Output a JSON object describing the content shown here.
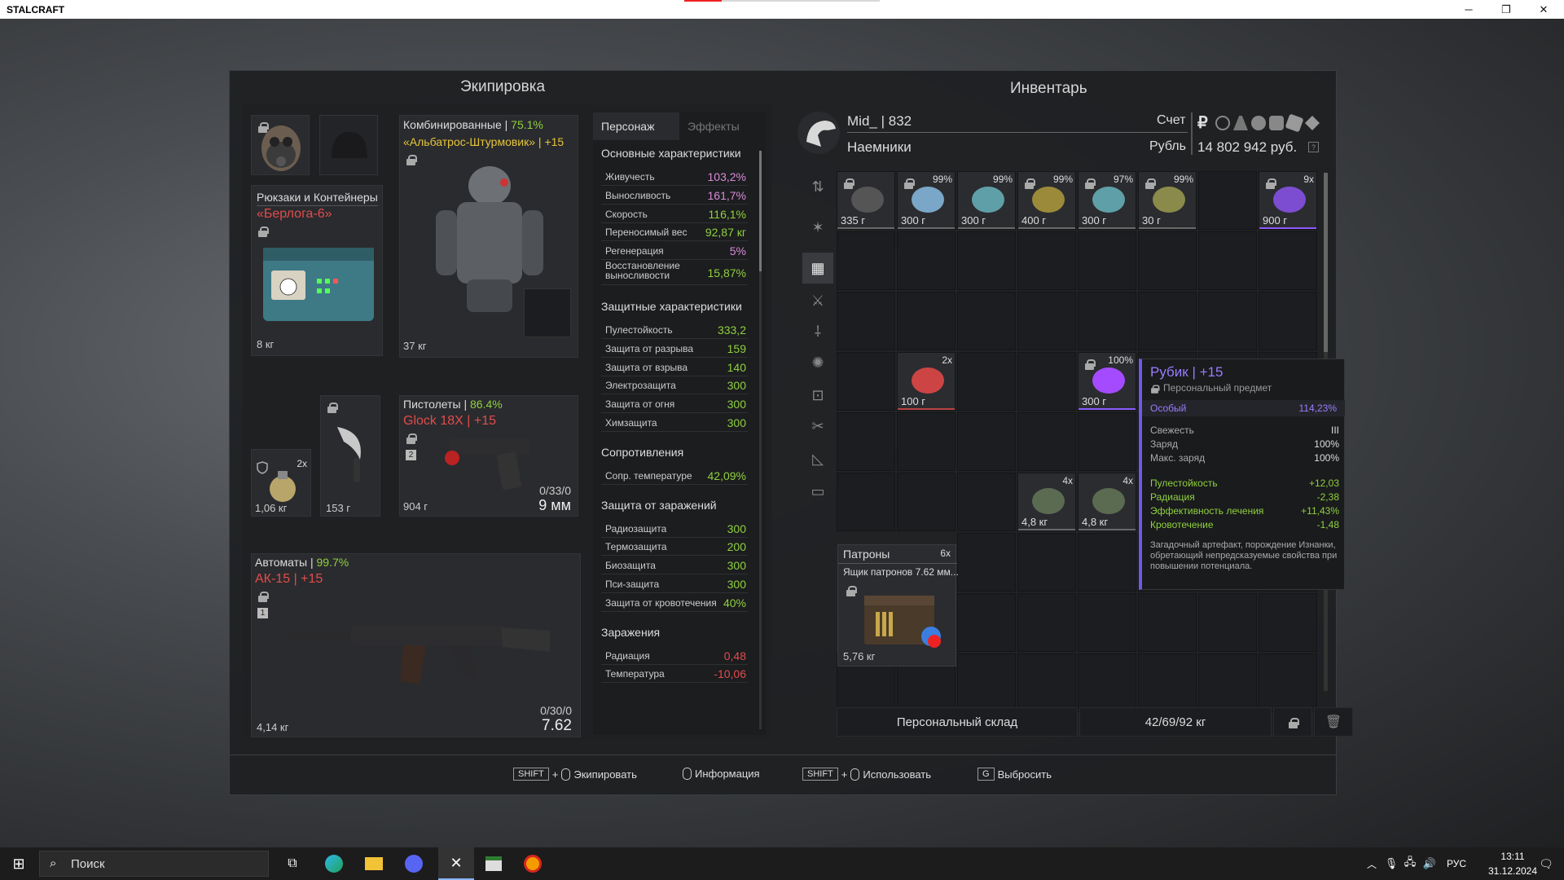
{
  "window": {
    "title": "STALCRAFT"
  },
  "equipment": {
    "title": "Экипировка",
    "backpack": {
      "category": "Рюкзаки и Контейнеры",
      "name": "«Берлога-6»",
      "weight": "8 кг"
    },
    "armor": {
      "category": "Комбинированные",
      "sep": "|",
      "condition": "75.1%",
      "name": "«Альбатрос-Штурмовик»",
      "upgrade": "| +15",
      "weight": "37 кг"
    },
    "grenade": {
      "count": "2x",
      "weight": "1,06 кг"
    },
    "knife": {
      "weight": "153 г"
    },
    "pistol": {
      "category": "Пистолеты",
      "condition": "86.4%",
      "name": "Glock 18X",
      "upgrade": "| +15",
      "badge": "2",
      "ammo": "0/33/0",
      "caliber": "9 мм",
      "weight": "904 г"
    },
    "rifle": {
      "category": "Автоматы",
      "condition": "99.7%",
      "name": "АК-15",
      "upgrade": "| +15",
      "badge": "1",
      "ammo": "0/30/0",
      "caliber": "7.62",
      "weight": "4,14 кг"
    }
  },
  "stats": {
    "tab_character": "Персонаж",
    "tab_effects": "Эффекты",
    "sections": [
      {
        "title": "Основные характеристики",
        "rows": [
          {
            "k": "Живучесть",
            "v": "103,2%",
            "c": "pink"
          },
          {
            "k": "Выносливость",
            "v": "161,7%",
            "c": "pink"
          },
          {
            "k": "Скорость",
            "v": "116,1%",
            "c": "green"
          },
          {
            "k": "Переносимый вес",
            "v": "92,87 кг",
            "c": "green"
          },
          {
            "k": "Регенерация",
            "v": "5%",
            "c": "pink"
          },
          {
            "k": "Восстановление выносливости",
            "v": "15,87%",
            "c": "green"
          }
        ]
      },
      {
        "title": "Защитные характеристики",
        "rows": [
          {
            "k": "Пулестойкость",
            "v": "333,2",
            "c": "green"
          },
          {
            "k": "Защита от разрыва",
            "v": "159",
            "c": "green"
          },
          {
            "k": "Защита от взрыва",
            "v": "140",
            "c": "green"
          },
          {
            "k": "Электрозащита",
            "v": "300",
            "c": "green"
          },
          {
            "k": "Защита от огня",
            "v": "300",
            "c": "green"
          },
          {
            "k": "Химзащита",
            "v": "300",
            "c": "green"
          }
        ]
      },
      {
        "title": "Сопротивления",
        "rows": [
          {
            "k": "Сопр. температуре",
            "v": "42,09%",
            "c": "green"
          }
        ]
      },
      {
        "title": "Защита от заражений",
        "rows": [
          {
            "k": "Радиозащита",
            "v": "300",
            "c": "green"
          },
          {
            "k": "Термозащита",
            "v": "200",
            "c": "green"
          },
          {
            "k": "Биозащита",
            "v": "300",
            "c": "green"
          },
          {
            "k": "Пси-защита",
            "v": "300",
            "c": "green"
          },
          {
            "k": "Защита от кровотечения",
            "v": "40%",
            "c": "green"
          }
        ]
      },
      {
        "title": "Заражения",
        "rows": [
          {
            "k": "Радиация",
            "v": "0,48",
            "c": "red"
          },
          {
            "k": "Температура",
            "v": "-10,06",
            "c": "red"
          }
        ]
      }
    ]
  },
  "inventory": {
    "title": "Инвентарь",
    "player": "Mid_",
    "sep": "|",
    "level": "832",
    "faction": "Наемники",
    "account_label": "Счет",
    "currency": "Рубль",
    "balance": "14 802 942 руб.",
    "ruble_sign": "₽",
    "items": [
      {
        "col": 0,
        "row": 0,
        "w": "335 г",
        "p": "",
        "locked": true
      },
      {
        "col": 1,
        "row": 0,
        "w": "300 г",
        "p": "99%",
        "locked": true
      },
      {
        "col": 2,
        "row": 0,
        "w": "300 г",
        "p": "99%",
        "locked": false
      },
      {
        "col": 3,
        "row": 0,
        "w": "400 г",
        "p": "99%",
        "locked": true
      },
      {
        "col": 4,
        "row": 0,
        "w": "300 г",
        "p": "97%",
        "locked": true
      },
      {
        "col": 5,
        "row": 0,
        "w": "30 г",
        "p": "99%",
        "locked": true
      },
      {
        "col": 7,
        "row": 0,
        "w": "900 г",
        "p": "9x",
        "locked": true
      },
      {
        "col": 1,
        "row": 3,
        "w": "100 г",
        "p": "2x",
        "locked": false
      },
      {
        "col": 4,
        "row": 3,
        "w": "300 г",
        "p": "100%",
        "locked": true
      },
      {
        "col": 3,
        "row": 5,
        "w": "4,8 кг",
        "p": "4x",
        "locked": false
      },
      {
        "col": 4,
        "row": 5,
        "w": "4,8 кг",
        "p": "4x",
        "locked": false
      }
    ],
    "ammo_box": {
      "category": "Патроны",
      "count": "6x",
      "name": "Ящик патронов 7.62 мм...",
      "weight": "5,76 кг"
    },
    "storage_label": "Персональный склад",
    "weight_summary": "42/69/92 кг"
  },
  "tooltip": {
    "name": "Рубик",
    "upgrade": "| +15",
    "personal": "Персональный предмет",
    "rarity": "Особый",
    "rarity_value": "114,23%",
    "props": [
      {
        "k": "Свежесть",
        "v": "III"
      },
      {
        "k": "Заряд",
        "v": "100%"
      },
      {
        "k": "Макс. заряд",
        "v": "100%"
      }
    ],
    "effects": [
      {
        "k": "Пулестойкость",
        "v": "+12,03"
      },
      {
        "k": "Радиация",
        "v": "-2,38"
      },
      {
        "k": "Эффективность лечения",
        "v": "+11,43%"
      },
      {
        "k": "Кровотечение",
        "v": "-1,48"
      }
    ],
    "description": "Загадочный артефакт, порождение Изнанки, обретающий непредсказуемые свойства при повышении потенциала."
  },
  "hints": {
    "shift": "SHIFT",
    "plus": "+",
    "equip": "Экипировать",
    "info": "Информация",
    "use": "Использовать",
    "g": "G",
    "drop": "Выбросить"
  },
  "taskbar": {
    "search": "Поиск",
    "lang": "РУС",
    "time": "13:11",
    "date": "31.12.2024"
  },
  "colors": {
    "accent": "#6e5ae6",
    "green": "#8fd13e",
    "red": "#e24c4c"
  }
}
